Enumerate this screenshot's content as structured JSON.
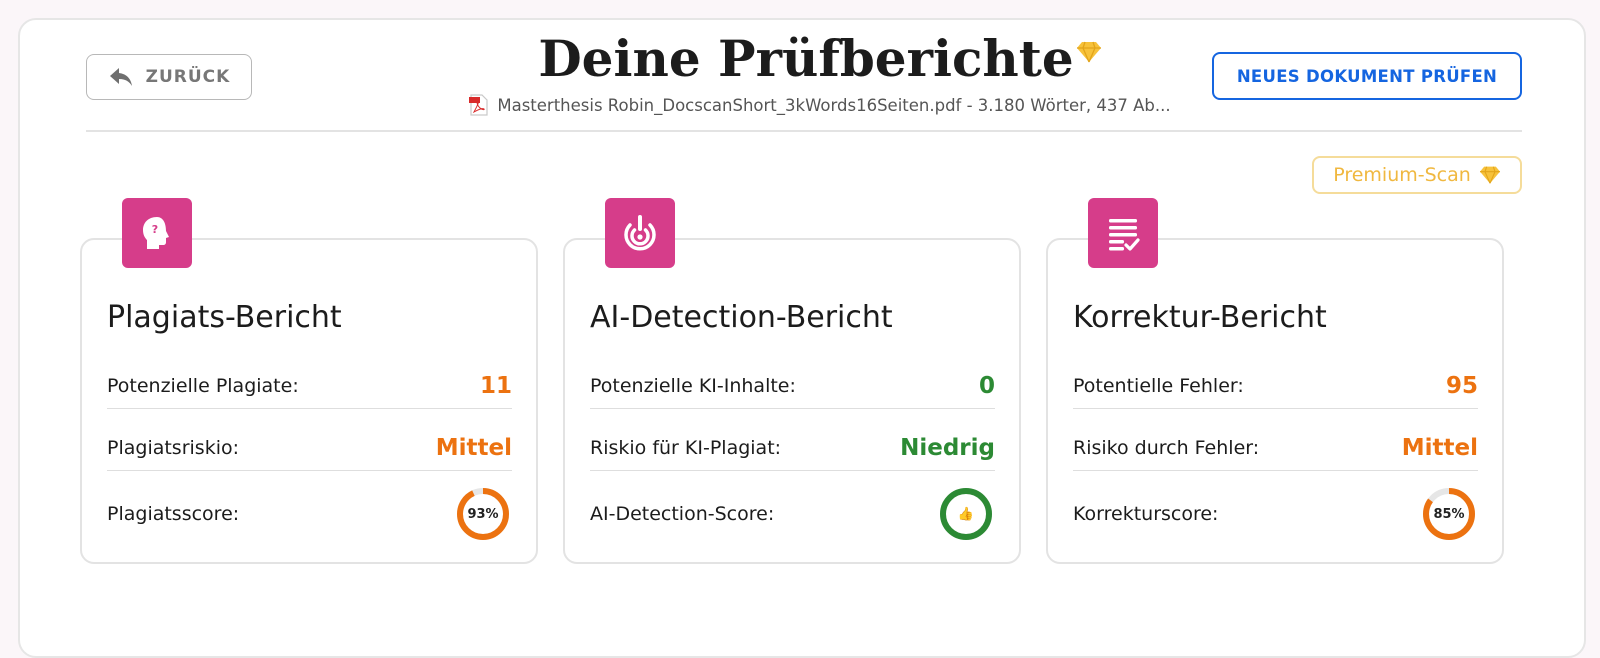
{
  "header": {
    "back_label": "ZURÜCK",
    "title": "Deine Prüfberichte",
    "file_info": "Masterthesis Robin_DocscanShort_3kWords16Seiten.pdf - 3.180 Wörter, 437 Ab...",
    "new_doc_label": "NEUES DOKUMENT PRÜFEN",
    "premium_label": "Premium-Scan"
  },
  "colors": {
    "accent_pink": "#d63d8a",
    "primary_blue": "#1565e0",
    "warning_orange": "#ec7210",
    "success_green": "#2c8a34",
    "premium_gold": "#f0b840"
  },
  "cards": [
    {
      "icon": "head-question-icon",
      "title": "Plagiats-Bericht",
      "rows": [
        {
          "label": "Potenzielle Plagiate:",
          "value": "11",
          "tone": "orange"
        },
        {
          "label": "Plagiatsriskio:",
          "value": "Mittel",
          "tone": "orange"
        }
      ],
      "score_label": "Plagiatsscore:",
      "score_text": "93%",
      "score_fraction": 0.93,
      "score_color": "#ec7210"
    },
    {
      "icon": "target-alert-icon",
      "title": "AI-Detection-Bericht",
      "rows": [
        {
          "label": "Potenzielle KI-Inhalte:",
          "value": "0",
          "tone": "green"
        },
        {
          "label": "Riskio für KI-Plagiat:",
          "value": "Niedrig",
          "tone": "green"
        }
      ],
      "score_label": "AI-Detection-Score:",
      "score_text": "👍",
      "score_fraction": 1.0,
      "score_color": "#2c8a34"
    },
    {
      "icon": "checklist-icon",
      "title": "Korrektur-Bericht",
      "rows": [
        {
          "label": "Potentielle Fehler:",
          "value": "95",
          "tone": "orange"
        },
        {
          "label": "Risiko durch Fehler:",
          "value": "Mittel",
          "tone": "orange"
        }
      ],
      "score_label": "Korrekturscore:",
      "score_text": "85%",
      "score_fraction": 0.85,
      "score_color": "#ec7210"
    }
  ]
}
